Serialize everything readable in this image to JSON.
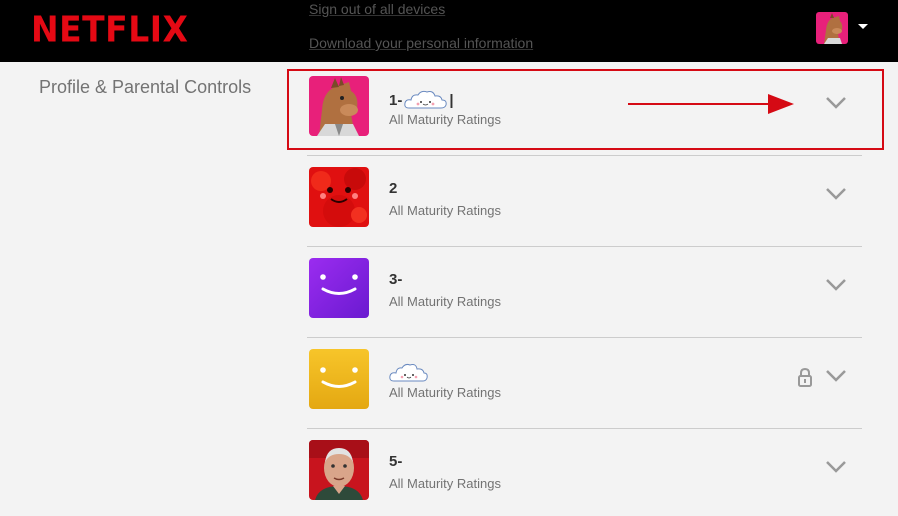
{
  "header": {
    "logo": "NETFLIX",
    "menu_items": [
      "Sign out of all devices",
      "Download your personal information"
    ]
  },
  "section": {
    "heading": "Profile & Parental Controls"
  },
  "profiles": [
    {
      "name": "1-",
      "name_suffix": "|",
      "rating": "All Maturity Ratings",
      "avatar": "horse",
      "locked": false
    },
    {
      "name": "2",
      "name_suffix": "",
      "rating": "All Maturity Ratings",
      "avatar": "red-monster",
      "locked": false
    },
    {
      "name": "3-",
      "name_suffix": "",
      "rating": "All Maturity Ratings",
      "avatar": "purple-smile",
      "locked": false
    },
    {
      "name": "",
      "name_suffix": "",
      "rating": "All Maturity Ratings",
      "avatar": "yellow-smile",
      "locked": true
    },
    {
      "name": "5-",
      "name_suffix": "",
      "rating": "All Maturity Ratings",
      "avatar": "old-man",
      "locked": false
    }
  ],
  "colors": {
    "brand_red": "#e50914",
    "annotation_red": "#d50a14",
    "page_bg": "#f3f3f3",
    "header_bg": "#000000"
  },
  "icons": [
    "chevron-down-icon",
    "lock-icon",
    "caret-down-icon",
    "cloud-emoji-icon"
  ]
}
